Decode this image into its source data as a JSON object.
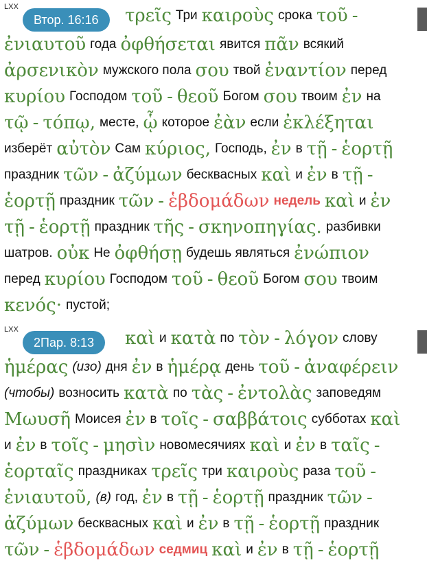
{
  "verses": [
    {
      "source": "LXX",
      "reference": "Втор. 16:16",
      "lines": [
        [
          [
            "g",
            "τρεῖς"
          ],
          [
            "r",
            "Три"
          ],
          [
            "g",
            "καιροὺς"
          ],
          [
            "r",
            "срока"
          ],
          [
            "g",
            "τοῦ"
          ],
          [
            "g",
            "-"
          ]
        ],
        [
          [
            "g",
            "ἐνιαυτοῦ"
          ],
          [
            "r",
            "года"
          ],
          [
            "g",
            "ὀφθήσεται"
          ],
          [
            "r",
            "явится"
          ],
          [
            "g",
            "πᾶν"
          ],
          [
            "r",
            "всякий"
          ]
        ],
        [
          [
            "g",
            "ἀρσενικὸν"
          ],
          [
            "r",
            "мужского пола"
          ],
          [
            "g",
            "σου"
          ],
          [
            "r",
            "твой"
          ],
          [
            "g",
            "ἐναντίον"
          ],
          [
            "r",
            "перед"
          ]
        ],
        [
          [
            "g",
            "κυρίου"
          ],
          [
            "r",
            "Господом"
          ],
          [
            "g",
            "τοῦ"
          ],
          [
            "g",
            "-"
          ],
          [
            "g",
            "θεοῦ"
          ],
          [
            "r",
            "Богом"
          ],
          [
            "g",
            "σου"
          ],
          [
            "r",
            "твоим"
          ],
          [
            "g",
            "ἐν"
          ],
          [
            "r",
            "на"
          ]
        ],
        [
          [
            "g",
            "τῷ"
          ],
          [
            "g",
            "-"
          ],
          [
            "g",
            "τόπῳ,"
          ],
          [
            "r",
            "месте,"
          ],
          [
            "g",
            "ᾧ"
          ],
          [
            "r",
            "которое"
          ],
          [
            "g",
            "ἐὰν"
          ],
          [
            "r",
            "если"
          ],
          [
            "g",
            "ἐκλέξηται"
          ]
        ],
        [
          [
            "r",
            "изберёт"
          ],
          [
            "g",
            "αὐτὸν"
          ],
          [
            "r",
            "Сам"
          ],
          [
            "g",
            "κύριος,"
          ],
          [
            "r",
            "Господь,"
          ],
          [
            "g",
            "ἐν"
          ],
          [
            "r",
            "в"
          ],
          [
            "g",
            "τῇ"
          ],
          [
            "g",
            "-"
          ],
          [
            "g",
            "ἑορτῇ"
          ]
        ],
        [
          [
            "r",
            "праздник"
          ],
          [
            "g",
            "τῶν"
          ],
          [
            "g",
            "-"
          ],
          [
            "g",
            "ἀζύμων"
          ],
          [
            "r",
            "бесквасных"
          ],
          [
            "g",
            "καὶ"
          ],
          [
            "r",
            "и"
          ],
          [
            "g",
            "ἐν"
          ],
          [
            "r",
            "в"
          ],
          [
            "g",
            "τῇ"
          ],
          [
            "g",
            "-"
          ]
        ],
        [
          [
            "g",
            "ἑορτῇ"
          ],
          [
            "r",
            "праздник"
          ],
          [
            "g",
            "τῶν"
          ],
          [
            "g",
            "-"
          ],
          [
            "hg",
            "ἑβδομάδων"
          ],
          [
            "hr",
            "недель"
          ],
          [
            "g",
            "καὶ"
          ],
          [
            "r",
            "и"
          ],
          [
            "g",
            "ἐν"
          ]
        ],
        [
          [
            "g",
            "τῇ"
          ],
          [
            "g",
            "-"
          ],
          [
            "g",
            "ἑορτῇ"
          ],
          [
            "r",
            "праздник"
          ],
          [
            "g",
            "τῆς"
          ],
          [
            "g",
            "-"
          ],
          [
            "g",
            "σκηνοπηγίας."
          ],
          [
            "r",
            "разбивки"
          ]
        ],
        [
          [
            "r",
            "шатров."
          ],
          [
            "g",
            "οὐκ"
          ],
          [
            "r",
            "Не"
          ],
          [
            "g",
            "ὀφθήσῃ"
          ],
          [
            "r",
            "будешь являться"
          ],
          [
            "g",
            "ἐνώπιον"
          ]
        ],
        [
          [
            "r",
            "перед"
          ],
          [
            "g",
            "κυρίου"
          ],
          [
            "r",
            "Господом"
          ],
          [
            "g",
            "τοῦ"
          ],
          [
            "g",
            "-"
          ],
          [
            "g",
            "θεοῦ"
          ],
          [
            "r",
            "Богом"
          ],
          [
            "g",
            "σου"
          ],
          [
            "r",
            "твоим"
          ]
        ],
        [
          [
            "g",
            "κενός·"
          ],
          [
            "r",
            "пустой;"
          ]
        ]
      ]
    },
    {
      "source": "LXX",
      "reference": "2Пар. 8:13",
      "lines": [
        [
          [
            "g",
            "καὶ"
          ],
          [
            "r",
            "и"
          ],
          [
            "g",
            "κατὰ"
          ],
          [
            "r",
            "по"
          ],
          [
            "g",
            "τὸν"
          ],
          [
            "g",
            "-"
          ],
          [
            "g",
            "λόγον"
          ],
          [
            "r",
            "слову"
          ]
        ],
        [
          [
            "g",
            "ἡμέρας"
          ],
          [
            "i",
            "(изо)"
          ],
          [
            "r",
            "дня"
          ],
          [
            "g",
            "ἐν"
          ],
          [
            "r",
            "в"
          ],
          [
            "g",
            "ἡμέρᾳ"
          ],
          [
            "r",
            "день"
          ],
          [
            "g",
            "τοῦ"
          ],
          [
            "g",
            "-"
          ],
          [
            "g",
            "ἀναφέρειν"
          ]
        ],
        [
          [
            "i",
            "(чтобы)"
          ],
          [
            "r",
            "возносить"
          ],
          [
            "g",
            "κατὰ"
          ],
          [
            "r",
            "по"
          ],
          [
            "g",
            "τὰς"
          ],
          [
            "g",
            "-"
          ],
          [
            "g",
            "ἐντολὰς"
          ],
          [
            "r",
            "заповедям"
          ]
        ],
        [
          [
            "g",
            "Μωυσῆ"
          ],
          [
            "r",
            "Моисея"
          ],
          [
            "g",
            "ἐν"
          ],
          [
            "r",
            "в"
          ],
          [
            "g",
            "τοῖς"
          ],
          [
            "g",
            "-"
          ],
          [
            "g",
            "σαββάτοις"
          ],
          [
            "r",
            "субботах"
          ],
          [
            "g",
            "καὶ"
          ]
        ],
        [
          [
            "r",
            "и"
          ],
          [
            "g",
            "ἐν"
          ],
          [
            "r",
            "в"
          ],
          [
            "g",
            "τοῖς"
          ],
          [
            "g",
            "-"
          ],
          [
            "g",
            "μησὶν"
          ],
          [
            "r",
            "новомесячиях"
          ],
          [
            "g",
            "καὶ"
          ],
          [
            "r",
            "и"
          ],
          [
            "g",
            "ἐν"
          ],
          [
            "r",
            "в"
          ],
          [
            "g",
            "ταῖς"
          ],
          [
            "g",
            "-"
          ]
        ],
        [
          [
            "g",
            "ἑορταῖς"
          ],
          [
            "r",
            "праздниках"
          ],
          [
            "g",
            "τρεῖς"
          ],
          [
            "r",
            "три"
          ],
          [
            "g",
            "καιροὺς"
          ],
          [
            "r",
            "раза"
          ],
          [
            "g",
            "τοῦ"
          ],
          [
            "g",
            "-"
          ]
        ],
        [
          [
            "g",
            "ἐνιαυτοῦ,"
          ],
          [
            "i",
            "(в)"
          ],
          [
            "r",
            "год,"
          ],
          [
            "g",
            "ἐν"
          ],
          [
            "r",
            "в"
          ],
          [
            "g",
            "τῇ"
          ],
          [
            "g",
            "-"
          ],
          [
            "g",
            "ἑορτῇ"
          ],
          [
            "r",
            "праздник"
          ],
          [
            "g",
            "τῶν"
          ],
          [
            "g",
            "-"
          ]
        ],
        [
          [
            "g",
            "ἀζύμων"
          ],
          [
            "r",
            "бесквасных"
          ],
          [
            "g",
            "καὶ"
          ],
          [
            "r",
            "и"
          ],
          [
            "g",
            "ἐν"
          ],
          [
            "r",
            "в"
          ],
          [
            "g",
            "τῇ"
          ],
          [
            "g",
            "-"
          ],
          [
            "g",
            "ἑορτῇ"
          ],
          [
            "r",
            "праздник"
          ]
        ],
        [
          [
            "g",
            "τῶν"
          ],
          [
            "g",
            "-"
          ],
          [
            "hg",
            "ἑβδομάδων"
          ],
          [
            "hr",
            "седмиц"
          ],
          [
            "g",
            "καὶ"
          ],
          [
            "r",
            "и"
          ],
          [
            "g",
            "ἐν"
          ],
          [
            "r",
            "в"
          ],
          [
            "g",
            "τῇ"
          ],
          [
            "g",
            "-"
          ],
          [
            "g",
            "ἑορτῇ"
          ]
        ]
      ]
    }
  ]
}
